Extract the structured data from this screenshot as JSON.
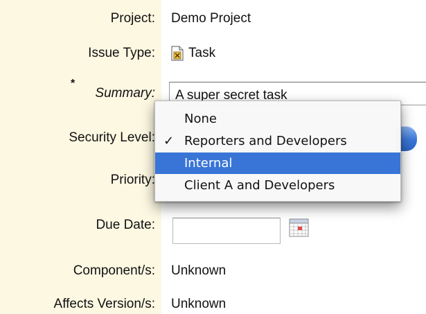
{
  "form": {
    "project": {
      "label": "Project:",
      "value": "Demo Project"
    },
    "issue_type": {
      "label": "Issue Type:",
      "value": "Task",
      "icon": "task-icon"
    },
    "summary": {
      "required_mark": "*",
      "label": "Summary:",
      "value": "A super secret task"
    },
    "security_level": {
      "label": "Security Level:"
    },
    "priority": {
      "label": "Priority:"
    },
    "due_date": {
      "label": "Due Date:",
      "value": "",
      "icon": "calendar-icon"
    },
    "components": {
      "label": "Component/s:",
      "value": "Unknown"
    },
    "affects_versions": {
      "label": "Affects Version/s:",
      "value": "Unknown"
    }
  },
  "security_dropdown": {
    "selected": "Reporters and Developers",
    "highlighted": "Internal",
    "check_mark": "✓",
    "options": [
      "None",
      "Reporters and Developers",
      "Internal",
      "Client A and Developers"
    ]
  },
  "colors": {
    "label_background": "#fdf8e2",
    "highlight": "#3875d7",
    "select_accent": "#3b78d8"
  }
}
